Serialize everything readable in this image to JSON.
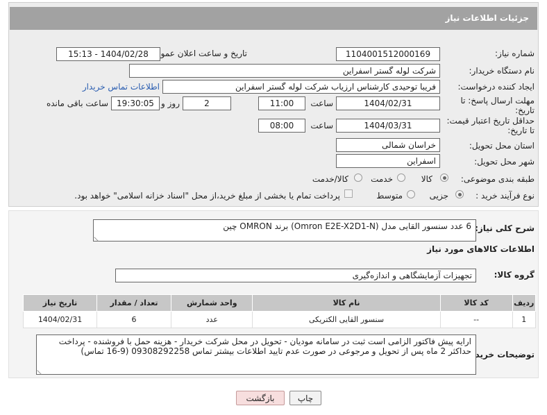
{
  "header": {
    "title": "جزئیات اطلاعات نیاز"
  },
  "form": {
    "need_number": {
      "label": "شماره نیاز:",
      "value": "1104001512000169"
    },
    "announce_datetime": {
      "label": "تاریخ و ساعت اعلان عمومی:",
      "value": "1404/02/28 - 15:13"
    },
    "buyer_org": {
      "label": "نام دستگاه خریدار:",
      "value": "شرکت لوله گستر اسفراین"
    },
    "requester": {
      "label": "ایجاد کننده درخواست:",
      "value": "فریبا توحیدی کارشناس ارزیاب شرکت لوله گستر اسفراین",
      "contact_link": "اطلاعات تماس خریدار"
    },
    "reply_deadline": {
      "label": "مهلت ارسال پاسخ: تا تاریخ:",
      "date": "1404/02/31",
      "time_label": "ساعت",
      "time": "11:00",
      "days": "2",
      "days_label": "روز و",
      "remaining": "19:30:05",
      "remaining_label": "ساعت باقی مانده"
    },
    "price_validity": {
      "label": "حداقل تاریخ اعتبار قیمت: تا تاریخ:",
      "date": "1404/03/31",
      "time_label": "ساعت",
      "time": "08:00"
    },
    "province": {
      "label": "استان محل تحویل:",
      "value": "خراسان شمالی"
    },
    "city": {
      "label": "شهر محل تحویل:",
      "value": "اسفراین"
    },
    "category": {
      "label": "طبقه بندی موضوعی:",
      "options": [
        "کالا",
        "خدمت",
        "کالا/خدمت"
      ],
      "selected": "کالا"
    },
    "process": {
      "label": "نوع فرآیند خرید :",
      "options": [
        "جزیی",
        "متوسط"
      ],
      "selected": "جزیی",
      "payment_note": "پرداخت تمام یا بخشی از مبلغ خرید،از محل \"اسناد خزانه اسلامی\" خواهد بود."
    }
  },
  "summary": {
    "label": "شرح کلی نیاز:",
    "value": "6 عدد سنسور القایی مدل (Omron E2E-X2D1-N) برند OMRON چین"
  },
  "goods_section": {
    "title": "اطلاعات کالاهای مورد نیاز",
    "group_label": "گروه کالا:",
    "group_value": "تجهیزات آزمایشگاهی و اندازه‌گیری"
  },
  "table": {
    "headers": [
      "ردیف",
      "کد کالا",
      "نام کالا",
      "واحد شمارش",
      "تعداد / مقدار",
      "تاریخ نیاز"
    ],
    "rows": [
      [
        "1",
        "--",
        "سنسور القایی الکتریکی",
        "عدد",
        "6",
        "1404/02/31"
      ]
    ]
  },
  "buyer_notes": {
    "label": "توضیحات خریدار:",
    "value": "ارایه پیش فاکتور الزامی است ثبت در سامانه مودیان - تحویل در محل شرکت خریدار - هزینه حمل با فروشنده - پرداخت حداکثر 2 ماه پس از تحویل و مرجوعی در صورت عدم تایید اطلاعات بیشتر تماس 09308292258 (9-16 تماس)"
  },
  "buttons": {
    "print": "چاپ",
    "back": "بازگشت"
  }
}
